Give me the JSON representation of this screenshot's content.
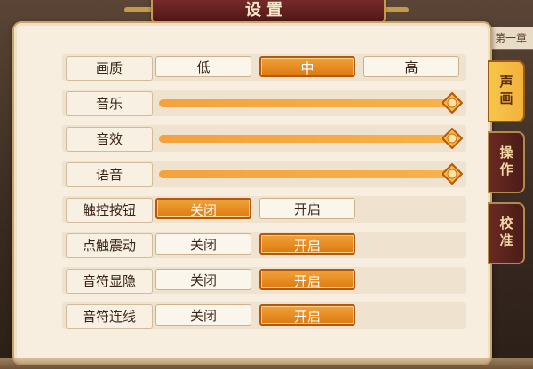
{
  "title": "设置",
  "background_strip": "第一章",
  "rows": [
    {
      "label": "画质",
      "type": "choice",
      "options": [
        "低",
        "中",
        "高"
      ],
      "selected": 1
    },
    {
      "label": "音乐",
      "type": "slider",
      "value": 1.0
    },
    {
      "label": "音效",
      "type": "slider",
      "value": 1.0
    },
    {
      "label": "语音",
      "type": "slider",
      "value": 1.0
    },
    {
      "label": "触控按钮",
      "type": "toggle",
      "options": [
        "关闭",
        "开启"
      ],
      "selected": 0
    },
    {
      "label": "点触震动",
      "type": "toggle",
      "options": [
        "关闭",
        "开启"
      ],
      "selected": 1
    },
    {
      "label": "音符显隐",
      "type": "toggle",
      "options": [
        "关闭",
        "开启"
      ],
      "selected": 1
    },
    {
      "label": "音符连线",
      "type": "toggle",
      "options": [
        "关闭",
        "开启"
      ],
      "selected": 1
    }
  ],
  "tabs": [
    {
      "label": "声画",
      "active": true
    },
    {
      "label": "操作",
      "active": false
    },
    {
      "label": "校准",
      "active": false
    }
  ],
  "colors": {
    "accent": "#e8891c",
    "panel": "#f7eee0",
    "tab_active": "#f5bf46",
    "tab_idle": "#5a2220"
  }
}
